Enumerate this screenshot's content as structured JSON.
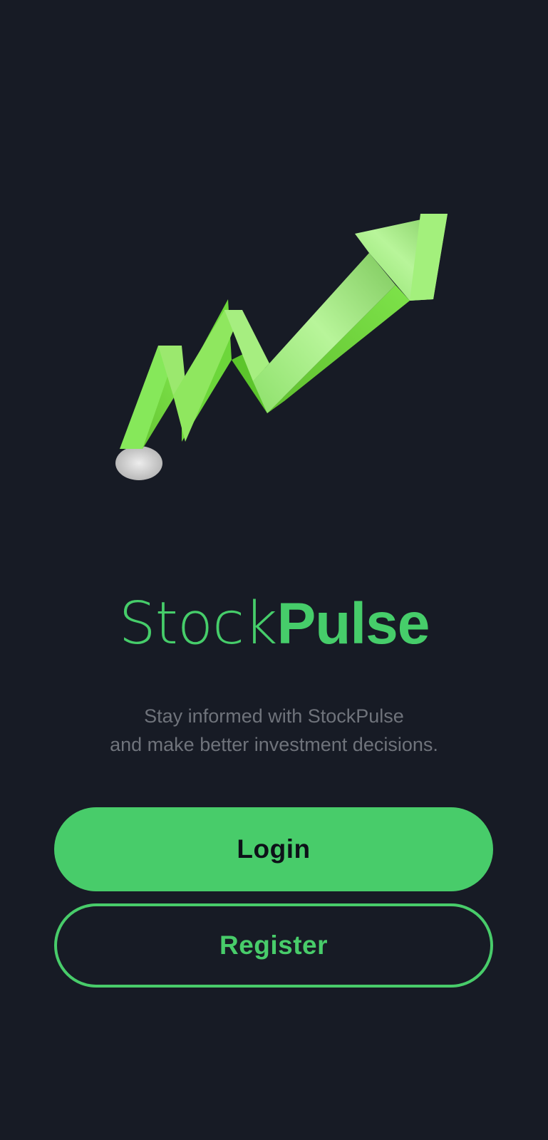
{
  "app": {
    "brand_light": "Stock",
    "brand_bold": "Pulse"
  },
  "tagline": {
    "line1": "Stay informed with StockPulse",
    "line2": "and make better investment decisions."
  },
  "buttons": {
    "login_label": "Login",
    "register_label": "Register"
  },
  "icons": {
    "hero": "rising-arrow-chart-icon"
  },
  "colors": {
    "background": "#171b25",
    "accent": "#48cc6a",
    "muted_text": "#6f737b"
  }
}
